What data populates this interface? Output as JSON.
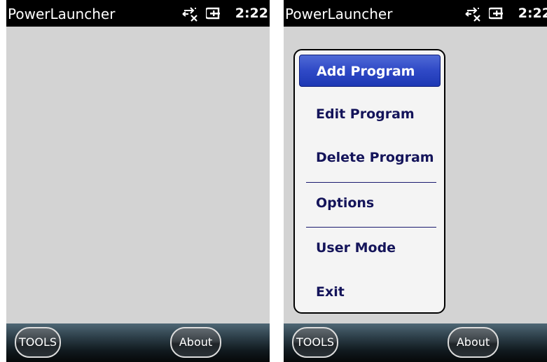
{
  "left_screen": {
    "title": "PowerLauncher",
    "time": "2:22",
    "softkeys": {
      "left": "TOOLS",
      "right": "About"
    }
  },
  "right_screen": {
    "title": "PowerLauncher",
    "time": "2:22",
    "softkeys": {
      "left": "TOOLS",
      "right": "About"
    },
    "menu": {
      "items": [
        {
          "label": "Add Program",
          "selected": true
        },
        {
          "label": "Edit Program"
        },
        {
          "label": "Delete Program"
        },
        {
          "label": "Options"
        },
        {
          "label": "User Mode"
        },
        {
          "label": "Exit"
        }
      ]
    }
  },
  "colors": {
    "titlebar": "#000000",
    "content": "#d3d3d3",
    "menu_text": "#14145a",
    "menu_selected": "#2f49c6"
  },
  "icons": [
    "sync-disconnected-icon",
    "battery-charging-icon"
  ]
}
